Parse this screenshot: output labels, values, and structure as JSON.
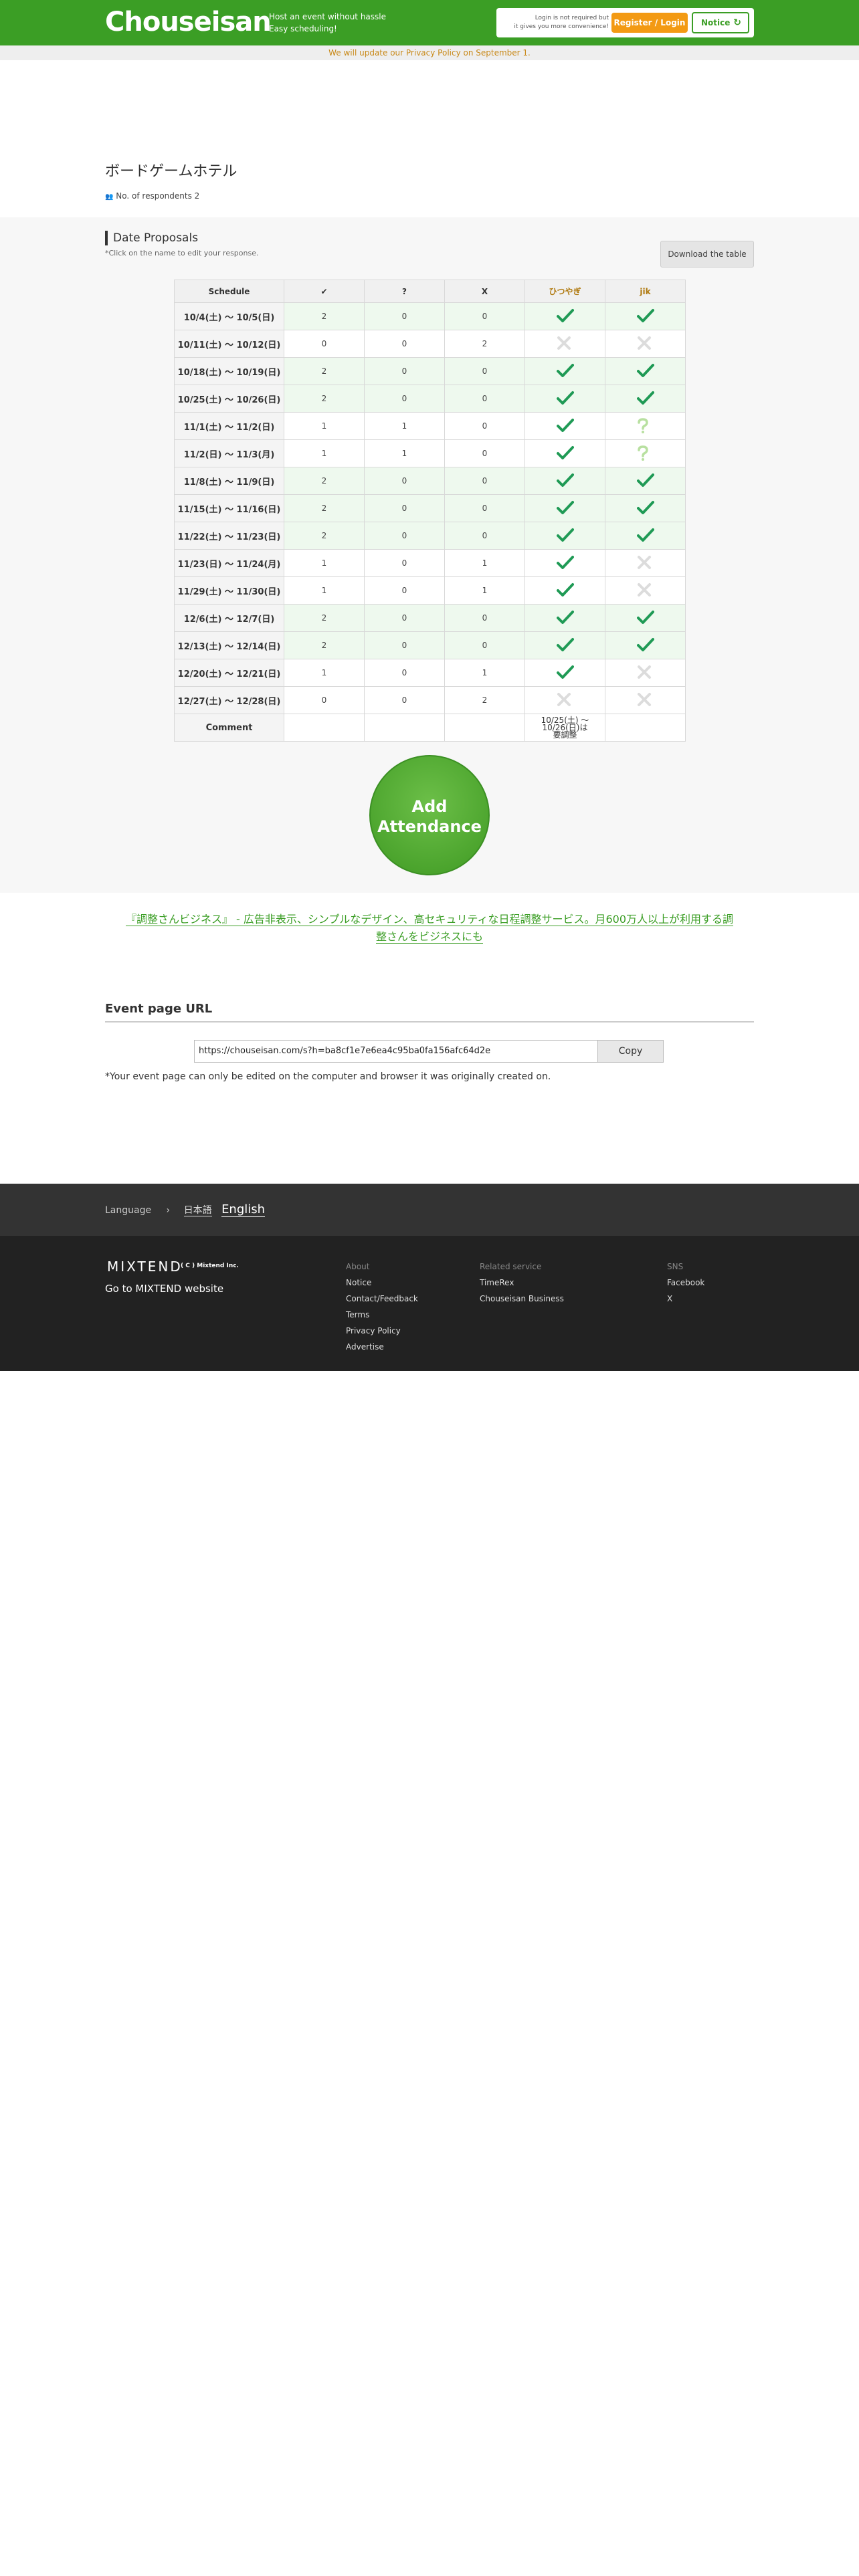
{
  "header": {
    "logo": "Chouseisan",
    "tagline_1": "Host an event without hassle",
    "tagline_2": "Easy scheduling!",
    "login_note_1": "Login is not required but",
    "login_note_2": "it gives you more convenience!",
    "register_label": "Register / Login",
    "notice_label": "Notice",
    "refresh_icon": "↻"
  },
  "privacy_notice": "We will update our Privacy Policy on September 1.",
  "event": {
    "title": "ボードゲームホテル",
    "respondents_icon": "👥",
    "respondents": "No. of respondents 2"
  },
  "proposals": {
    "heading": "Date Proposals",
    "hint": "*Click on the name to edit your response.",
    "download_label": "Download the table",
    "columns": [
      "Schedule",
      "✔",
      "?",
      "X",
      "ひつやぎ",
      "jik"
    ],
    "rows": [
      {
        "date": "10/4(土) 〜 10/5(日)",
        "yes": "2",
        "maybe": "0",
        "no": "0",
        "p1": "o",
        "p2": "o",
        "best": true
      },
      {
        "date": "10/11(土) 〜 10/12(日)",
        "yes": "0",
        "maybe": "0",
        "no": "2",
        "p1": "x",
        "p2": "x",
        "best": false
      },
      {
        "date": "10/18(土) 〜 10/19(日)",
        "yes": "2",
        "maybe": "0",
        "no": "0",
        "p1": "o",
        "p2": "o",
        "best": true
      },
      {
        "date": "10/25(土) 〜 10/26(日)",
        "yes": "2",
        "maybe": "0",
        "no": "0",
        "p1": "o",
        "p2": "o",
        "best": true
      },
      {
        "date": "11/1(土) 〜 11/2(日)",
        "yes": "1",
        "maybe": "1",
        "no": "0",
        "p1": "o",
        "p2": "q",
        "best": false
      },
      {
        "date": "11/2(日) 〜 11/3(月)",
        "yes": "1",
        "maybe": "1",
        "no": "0",
        "p1": "o",
        "p2": "q",
        "best": false
      },
      {
        "date": "11/8(土) 〜 11/9(日)",
        "yes": "2",
        "maybe": "0",
        "no": "0",
        "p1": "o",
        "p2": "o",
        "best": true
      },
      {
        "date": "11/15(土) 〜 11/16(日)",
        "yes": "2",
        "maybe": "0",
        "no": "0",
        "p1": "o",
        "p2": "o",
        "best": true
      },
      {
        "date": "11/22(土) 〜 11/23(日)",
        "yes": "2",
        "maybe": "0",
        "no": "0",
        "p1": "o",
        "p2": "o",
        "best": true
      },
      {
        "date": "11/23(日) 〜 11/24(月)",
        "yes": "1",
        "maybe": "0",
        "no": "1",
        "p1": "o",
        "p2": "x",
        "best": false
      },
      {
        "date": "11/29(土) 〜 11/30(日)",
        "yes": "1",
        "maybe": "0",
        "no": "1",
        "p1": "o",
        "p2": "x",
        "best": false
      },
      {
        "date": "12/6(土) 〜 12/7(日)",
        "yes": "2",
        "maybe": "0",
        "no": "0",
        "p1": "o",
        "p2": "o",
        "best": true
      },
      {
        "date": "12/13(土) 〜 12/14(日)",
        "yes": "2",
        "maybe": "0",
        "no": "0",
        "p1": "o",
        "p2": "o",
        "best": true
      },
      {
        "date": "12/20(土) 〜 12/21(日)",
        "yes": "1",
        "maybe": "0",
        "no": "1",
        "p1": "o",
        "p2": "x",
        "best": false
      },
      {
        "date": "12/27(土) 〜 12/28(日)",
        "yes": "0",
        "maybe": "0",
        "no": "2",
        "p1": "x",
        "p2": "x",
        "best": false
      }
    ],
    "comment_label": "Comment",
    "comment_text_1": "10/25(土) 〜 10/26(日)は",
    "comment_text_2": "要調整"
  },
  "add_button": {
    "line1": "Add",
    "line2": "Attendance"
  },
  "business_link": {
    "line1": "『調整さんビジネス』 - 広告非表示、シンプルなデザイン、高セキュリティな日程調整サービス。月600万人以上が利用する調",
    "line2": "整さんをビジネスにも"
  },
  "event_url": {
    "heading": "Event page URL",
    "value": "https://chouseisan.com/s?h=ba8cf1e7e6ea4c95ba0fa156afc64d2e",
    "copy_label": "Copy",
    "note": "*Your event page can only be edited on the computer and browser it was originally created on."
  },
  "language": {
    "label": "Language",
    "separator": "›",
    "japanese": "日本語",
    "english": "English"
  },
  "footer": {
    "company_logo": "MIXTEND",
    "company_copy": "( C ) Mixtend Inc.",
    "company_link": "Go to MIXTEND website",
    "about_title": "About",
    "about_items": [
      "Notice",
      "Contact/Feedback",
      "Terms",
      "Privacy Policy",
      "Advertise"
    ],
    "related_title": "Related service",
    "related_items": [
      "TimeRex",
      "Chouseisan Business"
    ],
    "sns_title": "SNS",
    "sns_items": [
      "Facebook",
      "X"
    ]
  },
  "colors": {
    "brand_green": "#3b9e25",
    "orange": "#f39a13",
    "check_green": "#1f9a55",
    "cross_gray": "#dcdcdc",
    "question_green": "#b8e0a0"
  }
}
